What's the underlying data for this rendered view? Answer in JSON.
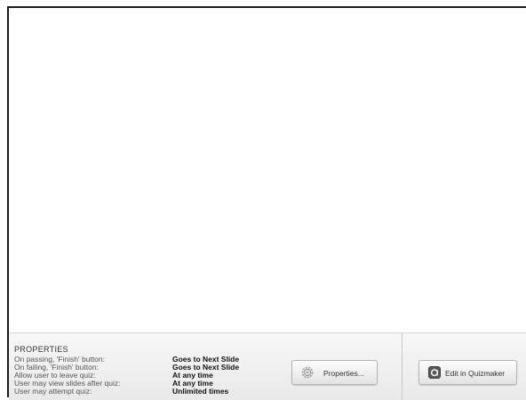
{
  "panel": {
    "title": "PROPERTIES",
    "rows": [
      {
        "label": "On passing, 'Finish' button:",
        "value": "Goes to Next Slide"
      },
      {
        "label": "On failing, 'Finish' button:",
        "value": "Goes to Next Slide"
      },
      {
        "label": "Allow user to leave quiz:",
        "value": "At any time"
      },
      {
        "label": "User may view slides after quiz:",
        "value": "At any time"
      },
      {
        "label": "User may attempt quiz:",
        "value": "Unlimited times"
      }
    ]
  },
  "buttons": {
    "properties_label": "Properties...",
    "properties_icon": "gear-icon",
    "quizmaker_label": "Edit in Quizmaker",
    "quizmaker_icon": "quizmaker-app-icon"
  },
  "colors": {
    "frame_border": "#1a1a1a",
    "panel_background": "#efefef",
    "divider": "#c8c8c8"
  }
}
